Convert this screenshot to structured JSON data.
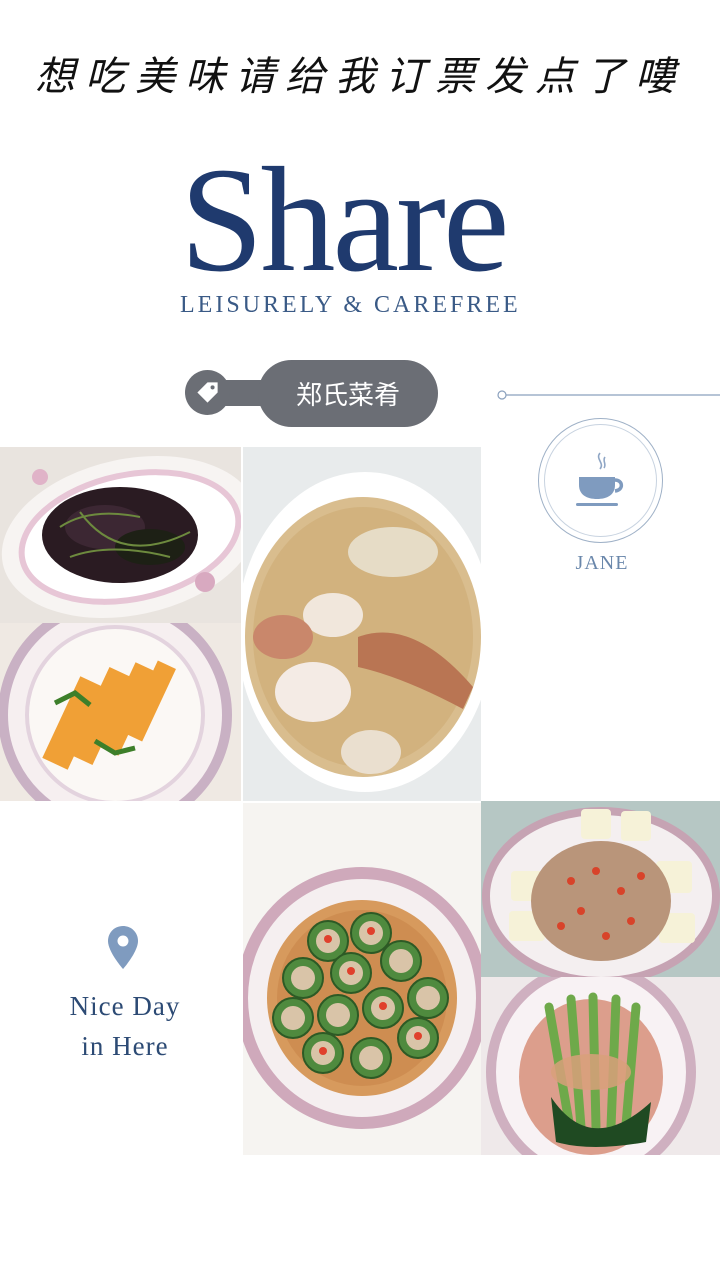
{
  "header": {
    "tagline": "想吃美味请给我订票发点了嘍"
  },
  "brand": {
    "title": "Share",
    "subtitle": "LEISURELY & CAREFREE"
  },
  "tag": {
    "label": "郑氏菜肴",
    "icon": "tag-icon"
  },
  "profile": {
    "icon": "coffee-cup-icon",
    "name": "JANE"
  },
  "location": {
    "icon": "location-pin-icon",
    "line1": "Nice Day",
    "line2": "in Here"
  },
  "colors": {
    "brand": "#1f3a6e",
    "tag_bg": "#6b6e75",
    "accent": "#7f9bbf"
  }
}
